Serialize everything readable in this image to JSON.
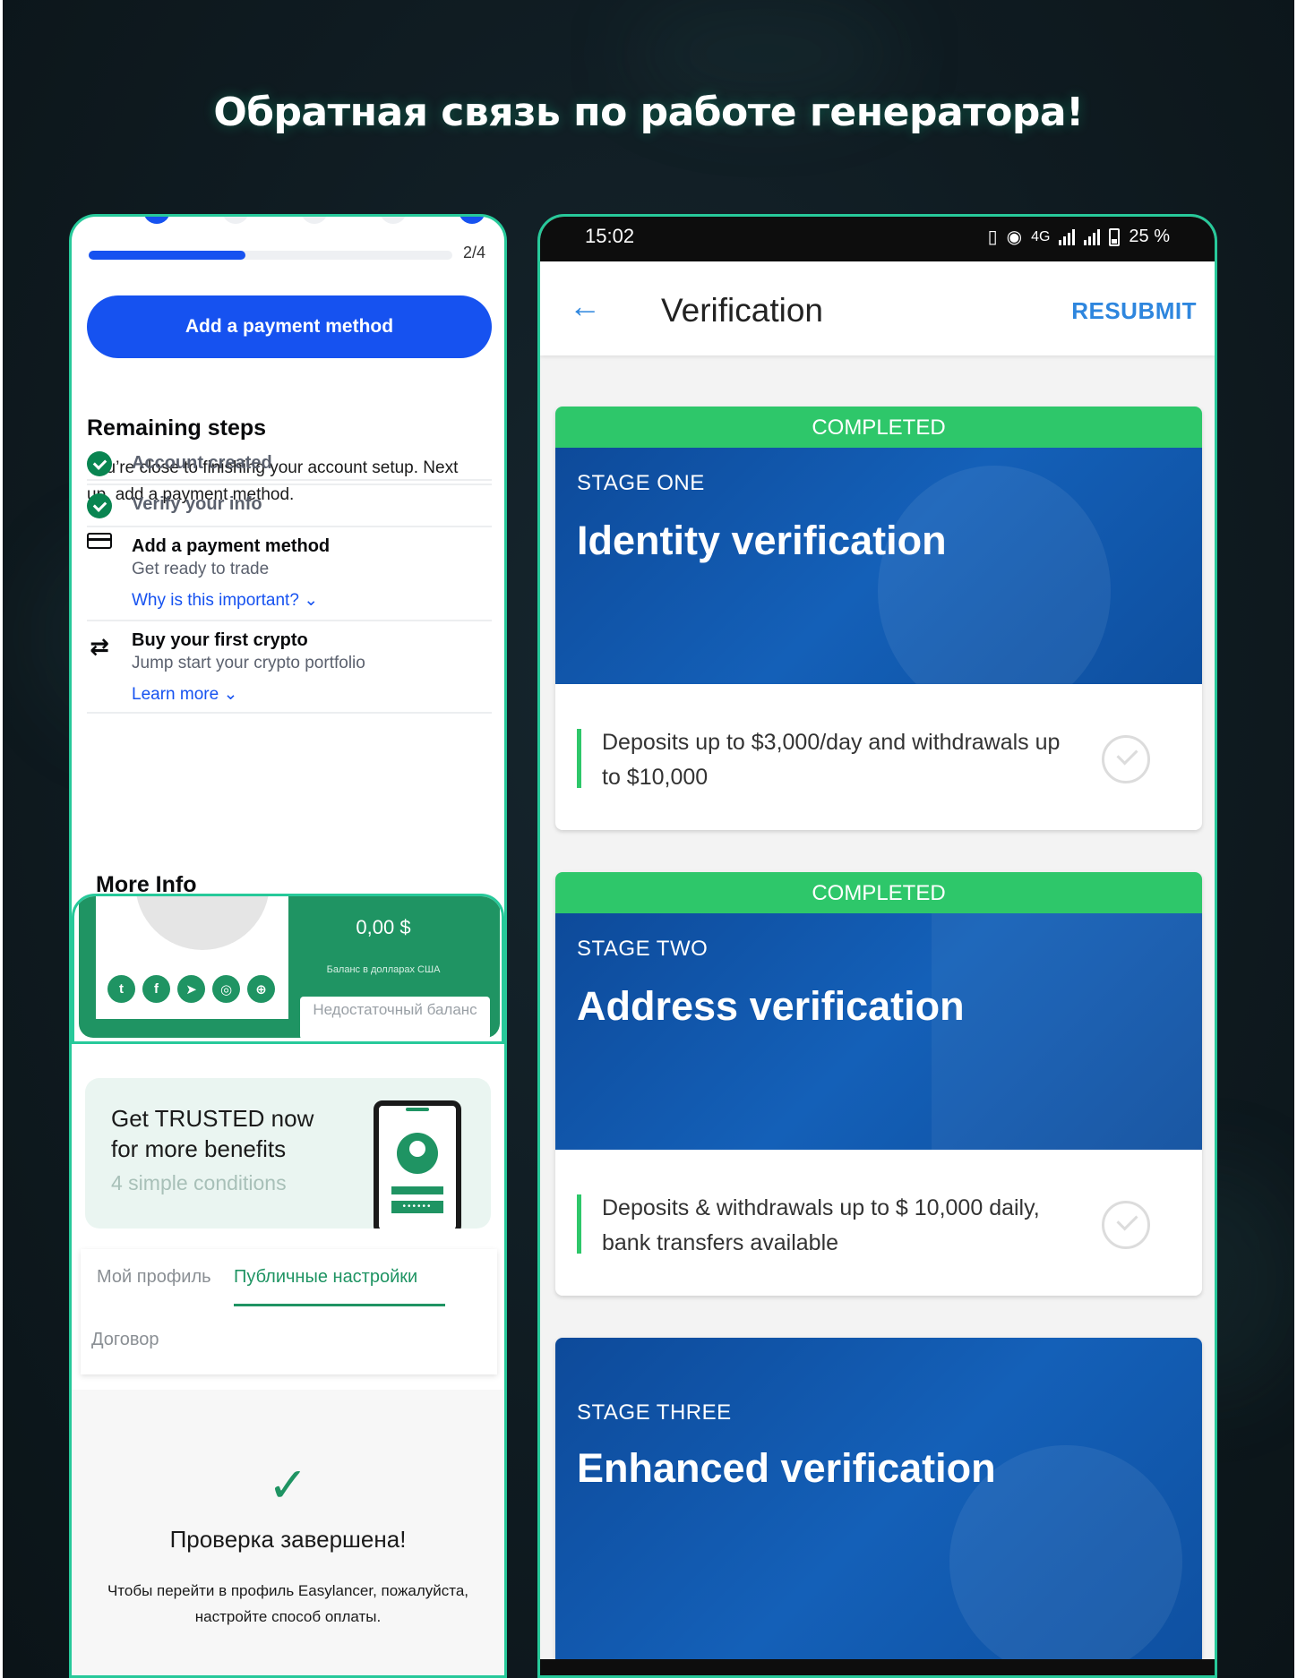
{
  "headline": "Обратная связь по работе генератора!",
  "left": {
    "progress": {
      "count_label": "2/4",
      "fraction": 0.43
    },
    "primary_button": "Add a payment method",
    "remaining": {
      "title": "Remaining steps",
      "description": "You’re close to finishing your account setup. Next up, add a payment method."
    },
    "steps": [
      {
        "label": "Account created",
        "status": "done"
      },
      {
        "label": "Verify your info",
        "status": "done"
      },
      {
        "label": "Add a payment method",
        "sub": "Get ready to trade",
        "link": "Why is this important?"
      },
      {
        "label": "Buy your first crypto",
        "sub": "Jump start your crypto portfolio",
        "link": "Learn more"
      }
    ],
    "more_info": "More Info",
    "balance": {
      "amount": "0,00 $",
      "caption": "Баланс в долларах США",
      "button": "Недостаточный баланс",
      "socials": [
        "twitter-icon",
        "facebook-icon",
        "telegram-icon",
        "instagram-icon",
        "globe-icon"
      ]
    },
    "trusted": {
      "title": "Get TRUSTED now for more benefits",
      "subtitle": "4 simple conditions",
      "card_dots": "••••••"
    },
    "tabs": {
      "profile": "Мой профиль",
      "public": "Публичные настройки",
      "contract": "Договор"
    },
    "done": {
      "icon": "✓",
      "title": "Проверка завершена!",
      "description": "Чтобы перейти в профиль Easylancer, пожалуйста, настройте способ оплаты."
    }
  },
  "right": {
    "status_bar": {
      "time": "15:02",
      "network": "4G",
      "battery": "25 %"
    },
    "appbar": {
      "back_icon": "←",
      "title": "Verification",
      "action": "RESUBMIT"
    },
    "cards": [
      {
        "banner": "COMPLETED",
        "stage": "STAGE ONE",
        "title": "Identity verification",
        "description": "Deposits up to $3,000/day and withdrawals up to $10,000"
      },
      {
        "banner": "COMPLETED",
        "stage": "STAGE TWO",
        "title": "Address verification",
        "description": "Deposits & withdrawals up to $ 10,000 daily, bank transfers available"
      },
      {
        "stage": "STAGE THREE",
        "title": "Enhanced verification"
      }
    ]
  },
  "colors": {
    "accent_green": "#27c99a",
    "coinbase_blue": "#1652f0",
    "easylancer_green": "#1f9463",
    "completed_green": "#2ec76a",
    "verification_blue": "#1460b8",
    "link_blue": "#2e86de"
  }
}
